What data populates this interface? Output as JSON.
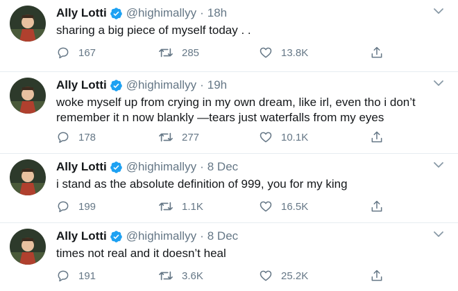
{
  "tweets": [
    {
      "name": "Ally Lotti",
      "handle": "@highimallyy",
      "separator": "·",
      "time": "18h",
      "text": "sharing a big piece of myself today . .",
      "replies": "167",
      "retweets": "285",
      "likes": "13.8K"
    },
    {
      "name": "Ally Lotti",
      "handle": "@highimallyy",
      "separator": "·",
      "time": "19h",
      "text": "woke myself up from crying in my own dream, like irl, even tho i don’t remember it n now blankly —tears just waterfalls from my eyes",
      "replies": "178",
      "retweets": "277",
      "likes": "10.1K"
    },
    {
      "name": "Ally Lotti",
      "handle": "@highimallyy",
      "separator": "·",
      "time": "8 Dec",
      "text": "i stand as the absolute definition of 999, you for my king",
      "replies": "199",
      "retweets": "1.1K",
      "likes": "16.5K"
    },
    {
      "name": "Ally Lotti",
      "handle": "@highimallyy",
      "separator": "·",
      "time": "8 Dec",
      "text": "times not real and it doesn’t heal",
      "replies": "191",
      "retweets": "3.6K",
      "likes": "25.2K"
    }
  ],
  "colors": {
    "text": "#14171a",
    "muted": "#657786",
    "verified": "#1da1f2",
    "divider": "#e6ecf0"
  },
  "icons": {
    "verified": "verified-badge-icon",
    "menu": "chevron-down-icon",
    "reply": "reply-bubble-icon",
    "retweet": "retweet-icon",
    "like": "heart-icon",
    "share": "share-icon"
  }
}
